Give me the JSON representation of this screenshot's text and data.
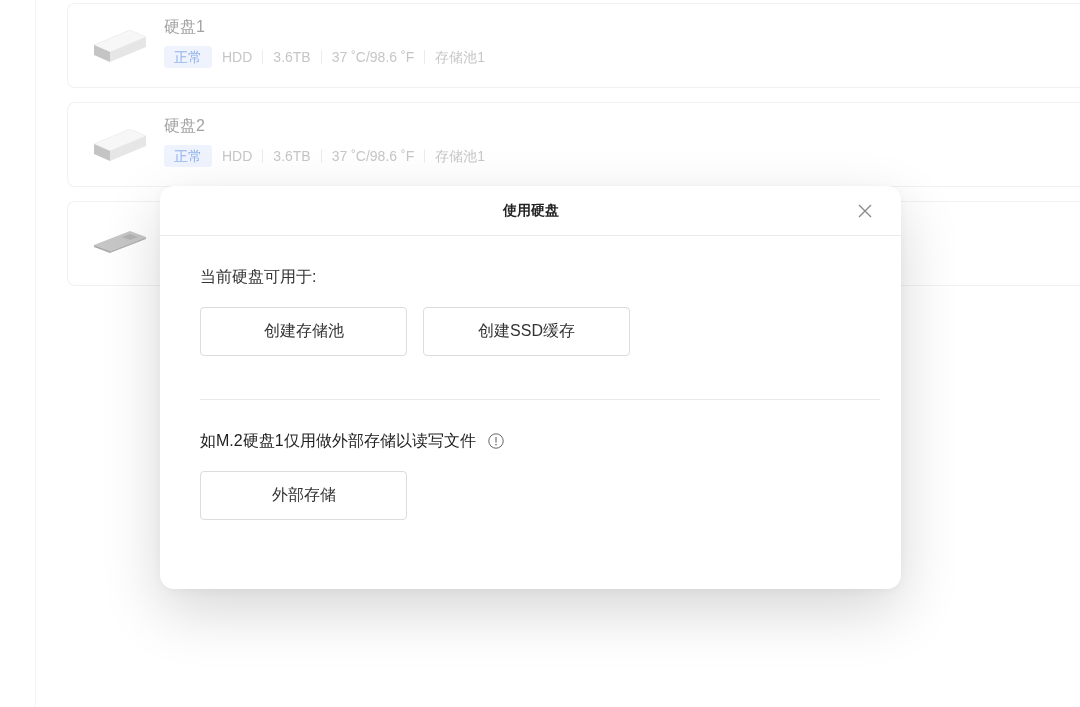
{
  "disks": [
    {
      "kind": "hdd",
      "name": "硬盘1",
      "status": "正常",
      "specs": [
        "HDD",
        "3.6TB",
        "37 ˚C/98.6 ˚F",
        "存储池1"
      ]
    },
    {
      "kind": "hdd",
      "name": "硬盘2",
      "status": "正常",
      "specs": [
        "HDD",
        "3.6TB",
        "37 ˚C/98.6 ˚F",
        "存储池1"
      ]
    },
    {
      "kind": "m2"
    }
  ],
  "dialog": {
    "title": "使用硬盘",
    "sections": [
      {
        "kind": "plain",
        "heading": "当前硬盘可用于:",
        "buttons": [
          "创建存储池",
          "创建SSD缓存"
        ]
      },
      {
        "kind": "info",
        "heading": "如M.2硬盘1仅用做外部存储以读写文件",
        "buttons": [
          "外部存储"
        ]
      }
    ]
  }
}
